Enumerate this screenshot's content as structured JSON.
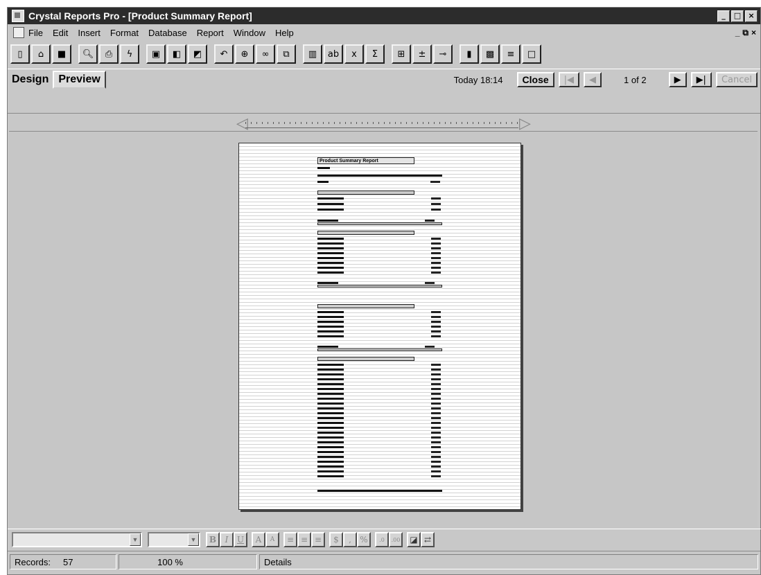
{
  "window": {
    "title": "Crystal Reports Pro - [Product Summary Report]"
  },
  "menu": [
    "File",
    "Edit",
    "Insert",
    "Format",
    "Database",
    "Report",
    "Window",
    "Help"
  ],
  "toolbar_icons": [
    "new-icon",
    "open-icon",
    "save-icon",
    "print-preview-icon",
    "print-icon",
    "export-icon",
    "camera-icon",
    "field-icon",
    "formula-icon",
    "undo-icon",
    "zoom-icon",
    "find-icon",
    "window-icon",
    "grid-icon",
    "text-field-icon",
    "formula-x-icon",
    "sum-icon",
    "group-icon",
    "sort-icon",
    "link-icon",
    "chart-icon",
    "picture-icon",
    "lines-icon",
    "box-icon"
  ],
  "tabs": {
    "design": "Design",
    "preview": "Preview"
  },
  "nav": {
    "date": "Today 18:14",
    "close": "Close",
    "page": "1 of 2",
    "cancel": "Cancel"
  },
  "report_page": {
    "title": "Product Summary Report"
  },
  "status": {
    "records_label": "Records:",
    "records_value": "57",
    "zoom": "100 %",
    "section": "Details"
  }
}
